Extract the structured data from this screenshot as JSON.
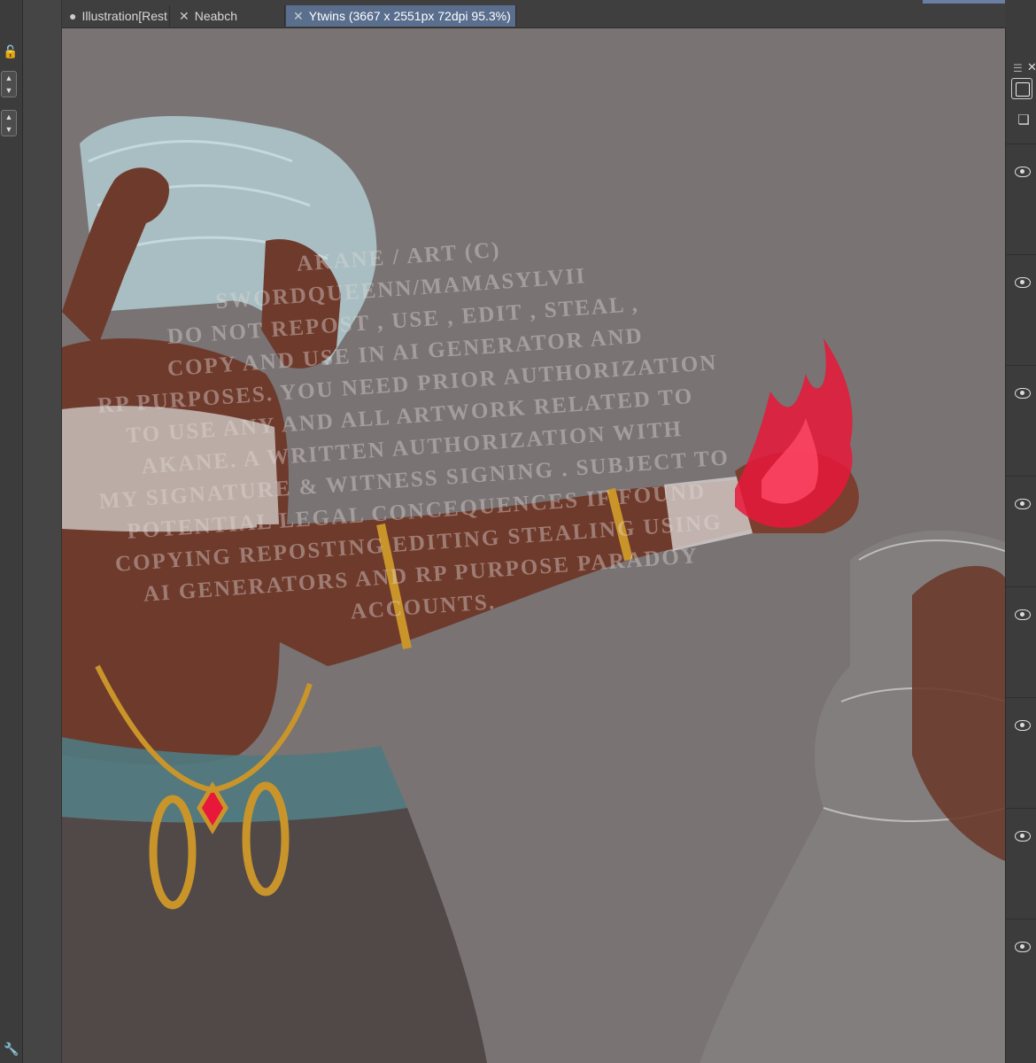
{
  "tabs": [
    {
      "label": "Illustration[Rest",
      "icon": "dot-icon",
      "active": false
    },
    {
      "label": "Neabch",
      "icon": "close-icon",
      "active": false
    },
    {
      "label": "Ytwins (3667 x 2551px 72dpi 95.3%)",
      "icon": "close-icon",
      "active": true
    }
  ],
  "left_toolbar": {
    "icons": [
      "lock-icon",
      "spinner-up-icon",
      "spinner-down-icon",
      "wrench-icon"
    ]
  },
  "layer_panel": {
    "icons": [
      "menu-icon",
      "close-icon",
      "layer-select-icon",
      "new-layer-icon",
      "eye-icon"
    ],
    "visible_layers": 8
  },
  "canvas": {
    "background_color": "#797373",
    "watermark_lines": [
      "AKANE / ART (C)",
      "SWORDQUEENN/MAMASYLVII",
      "Do not repost , use , edit , steal ,",
      "Copy and use in ai generator and",
      "RP purposes. You need prior authorization",
      "To use any and all artwork related to",
      "Akane. A written authorization with",
      "My signature & witness signing . Subject to",
      "Potential legal concequences if found",
      "Copying reposting editing stealing using",
      "Ai generators and RP purpose paradoy",
      "accounts."
    ]
  },
  "colors": {
    "accent_tab": "#5a6e8e",
    "ui_dark": "#3c3c3c",
    "flame": "#e8183a",
    "gold": "#c9952a",
    "skin": "#6e3a2c"
  }
}
